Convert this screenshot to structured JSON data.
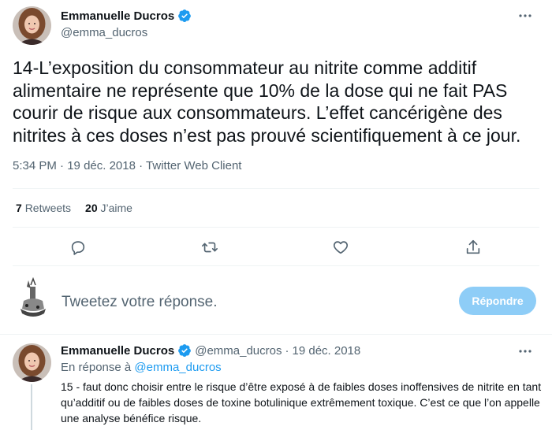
{
  "main_tweet": {
    "author_name": "Emmanuelle Ducros",
    "author_handle": "@emma_ducros",
    "text": "14-L’exposition du consommateur au nitrite comme additif alimentaire ne représente que 10% de la dose qui ne fait PAS courir de risque aux consommateurs. L’effet cancérigène des nitrites à ces doses n’est pas prouvé scientifiquement à ce jour.",
    "time": "5:34 PM",
    "date": "19 déc. 2018",
    "source": "Twitter Web Client",
    "separator": "·",
    "retweets_count": "7",
    "retweets_label": "Retweets",
    "likes_count": "20",
    "likes_label": "J’aime"
  },
  "icons": {
    "verified": "verified-badge-icon",
    "more": "more-icon",
    "reply": "reply-icon",
    "retweet": "retweet-icon",
    "like": "heart-icon",
    "share": "share-icon"
  },
  "compose": {
    "placeholder": "Tweetez votre réponse.",
    "button_label": "Répondre"
  },
  "reply_tweet": {
    "author_name": "Emmanuelle Ducros",
    "author_handle": "@emma_ducros",
    "separator": "·",
    "date": "19 déc. 2018",
    "in_reply_prefix": "En réponse à",
    "in_reply_mention": "@emma_ducros",
    "text": "15 - faut donc choisir entre le risque d’être exposé à de faibles doses inoffensives de nitrite en tant qu’additif ou de faibles doses de toxine botulinique extrêmement toxique. C’est ce que l’on appelle une analyse bénéfice risque."
  },
  "colors": {
    "accent": "#1d9bf0",
    "reply_button_disabled": "#8ecdf7",
    "muted_text": "#536471",
    "primary_text": "#0f1419",
    "divider": "#eff3f4"
  }
}
